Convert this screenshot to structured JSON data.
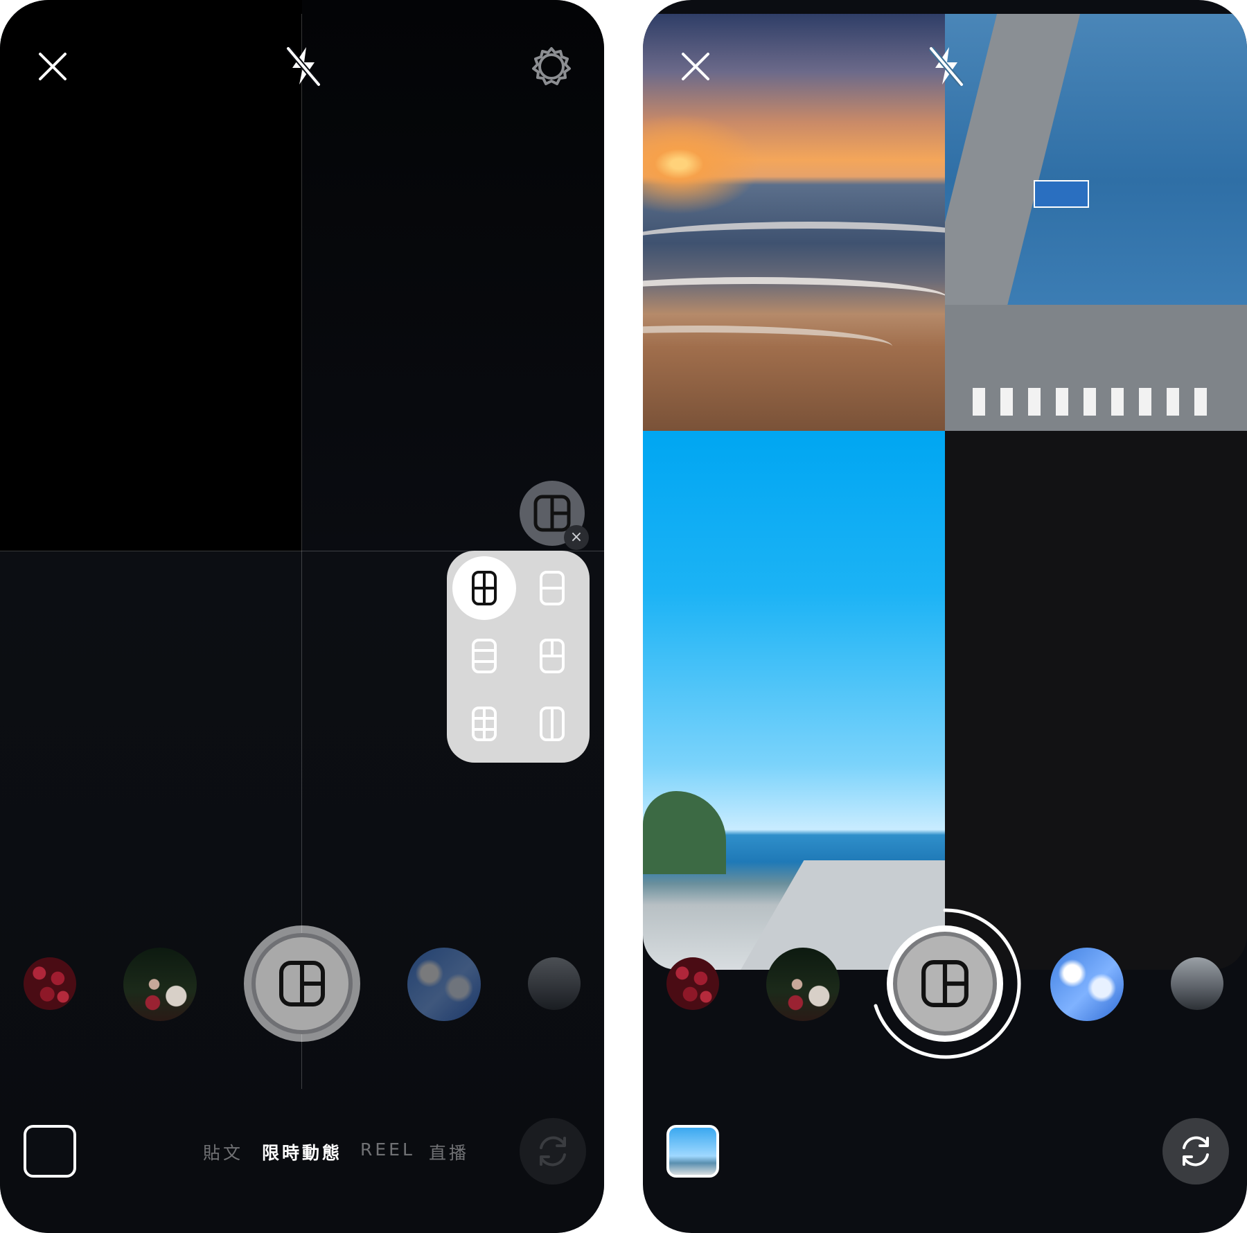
{
  "left_screen": {
    "mode_tabs": [
      {
        "label": "貼文",
        "active": false
      },
      {
        "label": "限時動態",
        "active": true
      },
      {
        "label": "REEL",
        "active": false
      },
      {
        "label": "直播",
        "active": false
      }
    ],
    "layout_options": [
      {
        "name": "grid-2x2",
        "selected": true
      },
      {
        "name": "two-rows",
        "selected": false
      },
      {
        "name": "three-rows",
        "selected": false
      },
      {
        "name": "top-split-bottom",
        "selected": false
      },
      {
        "name": "grid-2x3",
        "selected": false
      },
      {
        "name": "two-columns",
        "selected": false
      }
    ],
    "recent_thumbnails": [
      "cherries",
      "friends-night",
      "sky-palm",
      "street"
    ],
    "selected_layout_icon": "layout-grid-icon"
  },
  "right_screen": {
    "collage_cells": [
      "sunset-beach",
      "sea-bridge",
      "ocean-road",
      "empty"
    ],
    "recent_thumbnails": [
      "cherries",
      "friends-night",
      "sky-palm",
      "street"
    ]
  },
  "colors": {
    "screen_bg": "#0b0d12",
    "picker_bg": "#d8d8d8",
    "shutter_gray": "#a9a9a9",
    "white": "#ffffff"
  }
}
